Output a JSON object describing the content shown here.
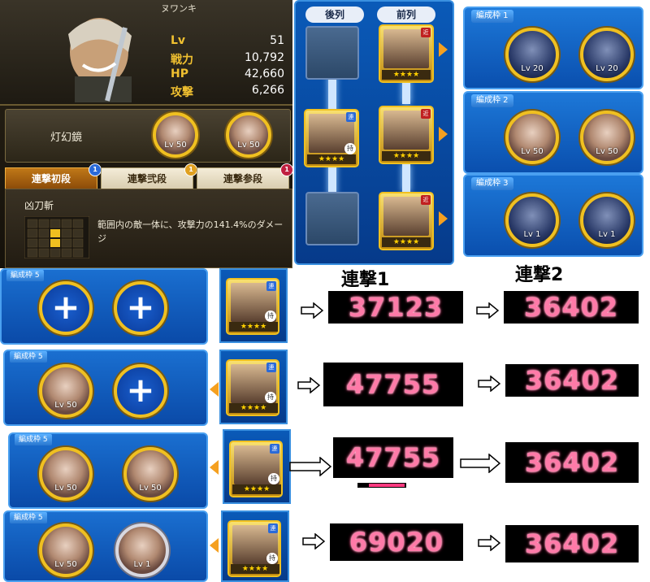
{
  "character": {
    "name": "ヌワンキ",
    "stats": [
      {
        "label": "Lv",
        "value": "51"
      },
      {
        "label": "戦力",
        "value": "10,792"
      },
      {
        "label": "HP",
        "value": "42,660"
      },
      {
        "label": "攻撃",
        "value": "6,266"
      }
    ],
    "mirror_label": "灯幻鏡",
    "mirror_slots": [
      {
        "lv": "Lv 50"
      },
      {
        "lv": "Lv 50"
      }
    ],
    "tabs": [
      {
        "label": "連撃初段",
        "badge": "1",
        "badge_color": "#2a6ad8",
        "active": true
      },
      {
        "label": "連撃弐段",
        "badge": "1",
        "badge_color": "#e0a020",
        "active": false
      },
      {
        "label": "連撃参段",
        "badge": "1",
        "badge_color": "#c02040",
        "active": false
      }
    ],
    "skill": {
      "name": "凶刀斬",
      "description": "範囲内の敵一体に、攻撃力の141.4%のダメージ"
    }
  },
  "lineup": {
    "back_label": "後列",
    "front_label": "前列",
    "badges": {
      "ren": "連",
      "kin": "近",
      "hold": "持"
    },
    "stars": "★★★★"
  },
  "formations": [
    {
      "label": "編成枠 1",
      "slots": [
        {
          "lv": "Lv 20"
        },
        {
          "lv": "Lv 20"
        }
      ]
    },
    {
      "label": "編成枠 2",
      "slots": [
        {
          "lv": "Lv 50"
        },
        {
          "lv": "Lv 50"
        }
      ]
    },
    {
      "label": "編成枠 3",
      "slots": [
        {
          "lv": "Lv 1"
        },
        {
          "lv": "Lv 1"
        }
      ]
    }
  ],
  "chain_headers": {
    "first": "連撃1",
    "second": "連撃2"
  },
  "rows": [
    {
      "label": "編成枠 5",
      "slots": [
        {
          "type": "plus",
          "lv": ""
        },
        {
          "type": "plus",
          "lv": ""
        }
      ],
      "damage1": "37123",
      "damage2": "36402"
    },
    {
      "label": "編成枠 5",
      "slots": [
        {
          "type": "coin",
          "lv": "Lv 50"
        },
        {
          "type": "plus",
          "lv": ""
        }
      ],
      "damage1": "47755",
      "damage2": "36402"
    },
    {
      "label": "編成枠 5",
      "slots": [
        {
          "type": "coin",
          "lv": "Lv 50"
        },
        {
          "type": "coin",
          "lv": "Lv 50"
        }
      ],
      "damage1": "47755",
      "damage2": "36402"
    },
    {
      "label": "編成枠 5",
      "slots": [
        {
          "type": "coin",
          "lv": "Lv 50"
        },
        {
          "type": "coin-silver",
          "lv": "Lv 1"
        }
      ],
      "damage1": "69020",
      "damage2": "36402"
    }
  ],
  "plus_glyph": "+",
  "colors": {
    "accent_gold": "#f0c020",
    "panel_blue": "#0a4fae",
    "damage_pink": "#ff7aa8"
  }
}
